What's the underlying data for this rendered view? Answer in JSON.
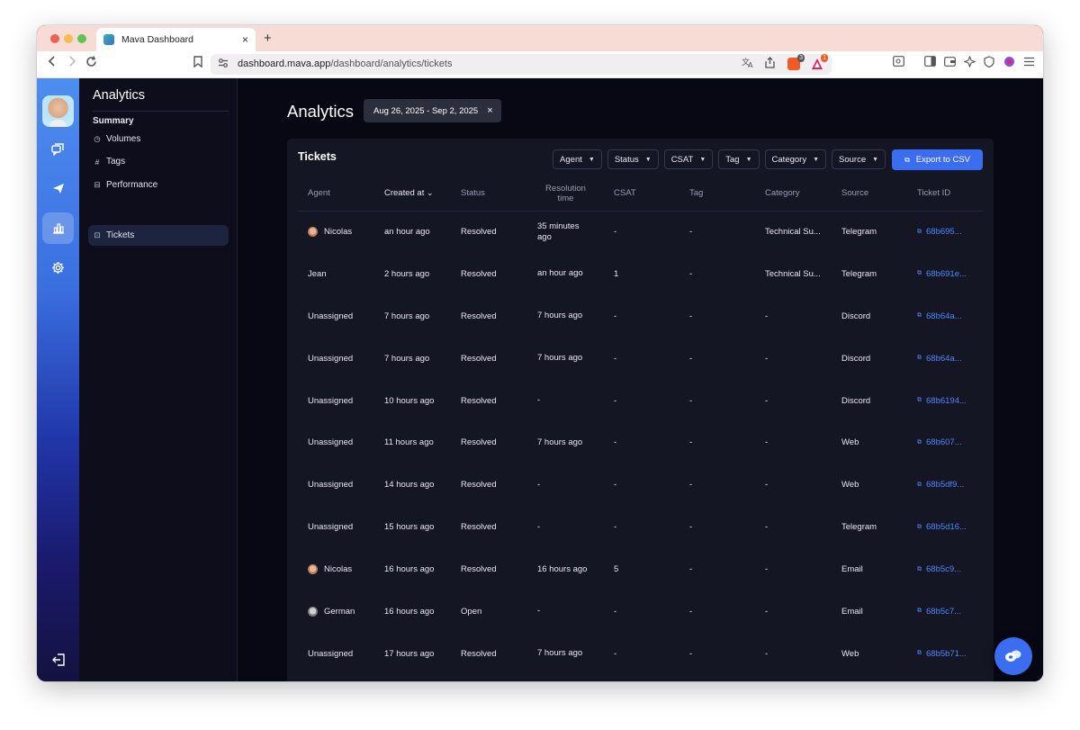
{
  "browser": {
    "tab_title": "Mava Dashboard",
    "tab_close": "×",
    "new_tab": "+",
    "url_host": "dashboard.mava.app",
    "url_path": "/dashboard/analytics/tickets",
    "brave_badge": "3",
    "rewards_badge": "1"
  },
  "sidebar": {
    "title": "Analytics",
    "section": "Summary",
    "items": [
      {
        "label": "Volumes",
        "icon": "pie-icon"
      },
      {
        "label": "Tags",
        "icon": "hash-icon"
      },
      {
        "label": "Performance",
        "icon": "chart-icon"
      },
      {
        "label": "Tickets",
        "icon": "ticket-icon",
        "active": true
      }
    ]
  },
  "main": {
    "title": "Analytics",
    "date_range": "Aug 26, 2025 - Sep 2, 2025",
    "date_clear": "×"
  },
  "card": {
    "title": "Tickets",
    "filters": [
      "Agent",
      "Status",
      "CSAT",
      "Tag",
      "Category",
      "Source"
    ],
    "export_label": "Export to CSV",
    "columns": [
      "Agent",
      "Created at",
      "Status",
      "Resolution time",
      "CSAT",
      "Tag",
      "Category",
      "Source",
      "Ticket ID"
    ],
    "sort_indicator": "⌄",
    "rows": [
      {
        "agent": "Nicolas",
        "avatar": "nicolas",
        "created": "an hour ago",
        "status": "Resolved",
        "resolution": "35 minutes ago",
        "csat": "-",
        "tag": "-",
        "category": "Technical Su...",
        "source": "Telegram",
        "ticket_id": "68b695..."
      },
      {
        "agent": "Jean",
        "avatar": "",
        "created": "2 hours ago",
        "status": "Resolved",
        "resolution": "an hour ago",
        "csat": "1",
        "tag": "-",
        "category": "Technical Su...",
        "source": "Telegram",
        "ticket_id": "68b691e..."
      },
      {
        "agent": "Unassigned",
        "avatar": "",
        "created": "7 hours ago",
        "status": "Resolved",
        "resolution": "7 hours ago",
        "csat": "-",
        "tag": "-",
        "category": "-",
        "source": "Discord",
        "ticket_id": "68b64a..."
      },
      {
        "agent": "Unassigned",
        "avatar": "",
        "created": "7 hours ago",
        "status": "Resolved",
        "resolution": "7 hours ago",
        "csat": "-",
        "tag": "-",
        "category": "-",
        "source": "Discord",
        "ticket_id": "68b64a..."
      },
      {
        "agent": "Unassigned",
        "avatar": "",
        "created": "10 hours ago",
        "status": "Resolved",
        "resolution": "-",
        "csat": "-",
        "tag": "-",
        "category": "-",
        "source": "Discord",
        "ticket_id": "68b6194..."
      },
      {
        "agent": "Unassigned",
        "avatar": "",
        "created": "11 hours ago",
        "status": "Resolved",
        "resolution": "7 hours ago",
        "csat": "-",
        "tag": "-",
        "category": "-",
        "source": "Web",
        "ticket_id": "68b607..."
      },
      {
        "agent": "Unassigned",
        "avatar": "",
        "created": "14 hours ago",
        "status": "Resolved",
        "resolution": "-",
        "csat": "-",
        "tag": "-",
        "category": "-",
        "source": "Web",
        "ticket_id": "68b5df9..."
      },
      {
        "agent": "Unassigned",
        "avatar": "",
        "created": "15 hours ago",
        "status": "Resolved",
        "resolution": "-",
        "csat": "-",
        "tag": "-",
        "category": "-",
        "source": "Telegram",
        "ticket_id": "68b5d16..."
      },
      {
        "agent": "Nicolas",
        "avatar": "nicolas",
        "created": "16 hours ago",
        "status": "Resolved",
        "resolution": "16 hours ago",
        "csat": "5",
        "tag": "-",
        "category": "-",
        "source": "Email",
        "ticket_id": "68b5c9..."
      },
      {
        "agent": "German",
        "avatar": "german",
        "created": "16 hours ago",
        "status": "Open",
        "resolution": "-",
        "csat": "-",
        "tag": "-",
        "category": "-",
        "source": "Email",
        "ticket_id": "68b5c7..."
      },
      {
        "agent": "Unassigned",
        "avatar": "",
        "created": "17 hours ago",
        "status": "Resolved",
        "resolution": "7 hours ago",
        "csat": "-",
        "tag": "-",
        "category": "-",
        "source": "Web",
        "ticket_id": "68b5b71..."
      }
    ]
  },
  "colors": {
    "accent": "#3b6df0",
    "link": "#4d86ff",
    "background": "#080814",
    "card": "#151624"
  }
}
